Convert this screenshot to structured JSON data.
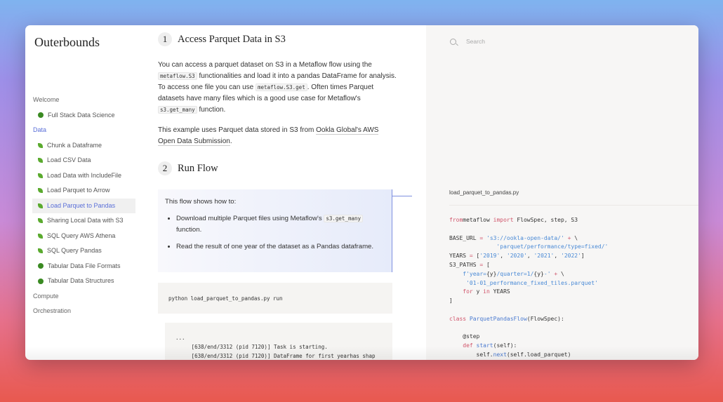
{
  "brand": "Outerbounds",
  "sidebar": {
    "welcome": "Welcome",
    "welcome_items": [
      {
        "label": "Full Stack Data Science",
        "icon": "tree-icon"
      }
    ],
    "data": "Data",
    "data_items": [
      {
        "label": "Chunk a Dataframe",
        "icon": "sprout-icon"
      },
      {
        "label": "Load CSV Data",
        "icon": "sprout-icon"
      },
      {
        "label": "Load Data with IncludeFile",
        "icon": "sprout-icon"
      },
      {
        "label": "Load Parquet to Arrow",
        "icon": "sprout-icon"
      },
      {
        "label": "Load Parquet to Pandas",
        "icon": "sprout-icon",
        "selected": true
      },
      {
        "label": "Sharing Local Data with S3",
        "icon": "sprout-icon"
      },
      {
        "label": "SQL Query AWS Athena",
        "icon": "sprout-icon"
      },
      {
        "label": "SQL Query Pandas",
        "icon": "sprout-icon"
      },
      {
        "label": "Tabular Data File Formats",
        "icon": "tree-icon"
      },
      {
        "label": "Tabular Data Structures",
        "icon": "tree-icon"
      }
    ],
    "compute": "Compute",
    "orchestration": "Orchestration",
    "accent": "#5a6fd8"
  },
  "main": {
    "step1": {
      "num": "1",
      "title": "Access Parquet Data in S3"
    },
    "p1": {
      "a": "You can access a parquet dataset on S3 in a Metaflow flow using the ",
      "c1": "metaflow.S3",
      "b": " functionalities and load it into a pandas DataFrame for analysis. To access one file you can use ",
      "c2": "metaflow.S3.get",
      "c": ". Often times Parquet datasets have many files which is a good use case for Metaflow's ",
      "c3": "s3.get_many",
      "d": " function."
    },
    "p2": {
      "a": "This example uses Parquet data stored in S3 from ",
      "link": "Ookla Global's AWS Open Data Submission",
      "b": "."
    },
    "step2": {
      "num": "2",
      "title": "Run Flow"
    },
    "box": {
      "intro": "This flow shows how to:",
      "li1a": "Download multiple Parquet files using Metaflow's ",
      "li1c": "s3.get_many",
      "li1b": " function.",
      "li2": "Read the result of one year of the dataset as a Pandas dataframe."
    },
    "command": "python load_parquet_to_pandas.py run",
    "output": "...\n     [638/end/3312 (pid 7120)] Task is starting.\n     [638/end/3312 (pid 7120)] DataFrame for first yearhas shap"
  },
  "right": {
    "search_placeholder": "Search",
    "filename": "load_parquet_to_pandas.py",
    "code": [
      [
        [
          "k",
          "from"
        ],
        [
          "",
          "metaflow "
        ],
        [
          "k",
          "import"
        ],
        [
          "",
          " FlowSpec, step, S3"
        ]
      ],
      [],
      [
        [
          "",
          "BASE_URL "
        ],
        [
          "k",
          "="
        ],
        [
          "s",
          " 's3://ookla-open-data/'"
        ],
        [
          "k",
          " +"
        ],
        [
          "",
          " \\"
        ]
      ],
      [
        [
          "s",
          "              'parquet/performance/type=fixed/'"
        ]
      ],
      [
        [
          "",
          "YEARS "
        ],
        [
          "k",
          "="
        ],
        [
          "",
          " ["
        ],
        [
          "s",
          "'2019'"
        ],
        [
          "",
          ", "
        ],
        [
          "s",
          "'2020'"
        ],
        [
          "",
          ", "
        ],
        [
          "s",
          "'2021'"
        ],
        [
          "",
          ", "
        ],
        [
          "s",
          "'2022'"
        ],
        [
          "",
          "]"
        ]
      ],
      [
        [
          "",
          "S3_PATHS "
        ],
        [
          "k",
          "="
        ],
        [
          "",
          " ["
        ]
      ],
      [
        [
          "s",
          "    f'year="
        ],
        [
          "",
          "{y}"
        ],
        [
          "s",
          "/quarter=1/"
        ],
        [
          "",
          "{y}"
        ],
        [
          "s",
          "-'"
        ],
        [
          "k",
          " +"
        ],
        [
          "",
          " \\"
        ]
      ],
      [
        [
          "s",
          "     '01-01_performance_fixed_tiles.parquet'"
        ]
      ],
      [
        [
          "k",
          "    for"
        ],
        [
          "",
          " y "
        ],
        [
          "k",
          "in"
        ],
        [
          "",
          " YEARS"
        ]
      ],
      [
        [
          "",
          "]"
        ]
      ],
      [],
      [
        [
          "k",
          "class"
        ],
        [
          "f",
          " ParquetPandasFlow"
        ],
        [
          "",
          "(FlowSpec):"
        ]
      ],
      [],
      [
        [
          "",
          "    @step"
        ]
      ],
      [
        [
          "k",
          "    def"
        ],
        [
          "f",
          " start"
        ],
        [
          "",
          "(self):"
        ]
      ],
      [
        [
          "",
          "        self."
        ],
        [
          "f",
          "next"
        ],
        [
          "",
          "(self.load_parquet)"
        ]
      ]
    ]
  }
}
